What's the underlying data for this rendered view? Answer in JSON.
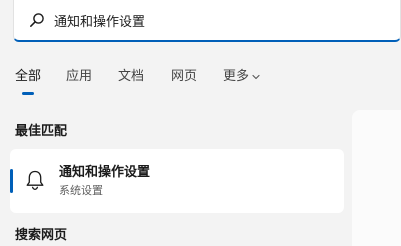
{
  "search": {
    "value": "通知和操作设置",
    "placeholder": ""
  },
  "tabs": [
    {
      "label": "全部",
      "active": true
    },
    {
      "label": "应用",
      "active": false
    },
    {
      "label": "文档",
      "active": false
    },
    {
      "label": "网页",
      "active": false
    },
    {
      "label": "更多",
      "active": false
    }
  ],
  "sections": {
    "best_match_title": "最佳匹配",
    "web_search_title": "搜索网页"
  },
  "best_match": {
    "title": "通知和操作设置",
    "subtitle": "系统设置",
    "icon": "bell-icon"
  },
  "colors": {
    "accent": "#005fb8",
    "background": "#f3f3f3",
    "card": "#ffffff"
  }
}
